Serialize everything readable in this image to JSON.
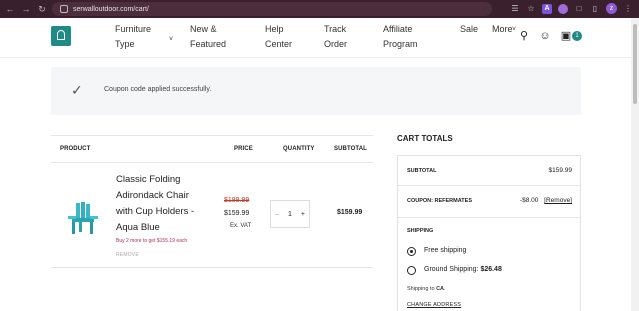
{
  "browser": {
    "url": "serwalloutdoor.com/cart/",
    "extension_a_label": "A",
    "avatar_letter": "z"
  },
  "header": {
    "nav": [
      {
        "line1": "Furniture",
        "line2": "Type"
      },
      {
        "line1": "New &",
        "line2": "Featured"
      },
      {
        "line1": "Help",
        "line2": "Center"
      },
      {
        "line1": "Track",
        "line2": "Order"
      },
      {
        "line1": "Affiliate",
        "line2": "Program"
      },
      {
        "line1": "Sale",
        "line2": ""
      },
      {
        "line1": "More",
        "line2": ""
      }
    ],
    "cart_count": "1"
  },
  "notice": {
    "text": "Coupon code applied successfully."
  },
  "table": {
    "headers": {
      "product": "PRODUCT",
      "price": "PRICE",
      "quantity": "QUANTITY",
      "subtotal": "SUBTOTAL"
    },
    "item": {
      "name": "Classic Folding Adirondack Chair with Cup Holders - Aqua Blue",
      "price_old": "$189.99",
      "price_new": "$159.99",
      "tax_note": "Ex. VAT",
      "quantity": "1",
      "subtotal": "$159.99",
      "promo": "Buy 2 more to get $155.19 each",
      "remove": "REMOVE"
    }
  },
  "totals": {
    "title": "CART TOTALS",
    "subtotal_label": "SUBTOTAL",
    "subtotal_value": "$159.99",
    "coupon_label": "COUPON: REFERMATES",
    "coupon_value": "-$8.00",
    "coupon_remove": "[Remove]",
    "shipping_label": "SHIPPING",
    "free_shipping": "Free shipping",
    "ground_shipping": "Ground Shipping:",
    "ground_price": "$26.48",
    "shipping_to": "Shipping to",
    "shipping_to_place": "CA",
    "change_address": "CHANGE ADDRESS"
  },
  "colors": {
    "brand": "#1f8a86",
    "chrome": "#3a1f2c",
    "sale_red": "#c0392b",
    "promo": "#b0305a"
  }
}
